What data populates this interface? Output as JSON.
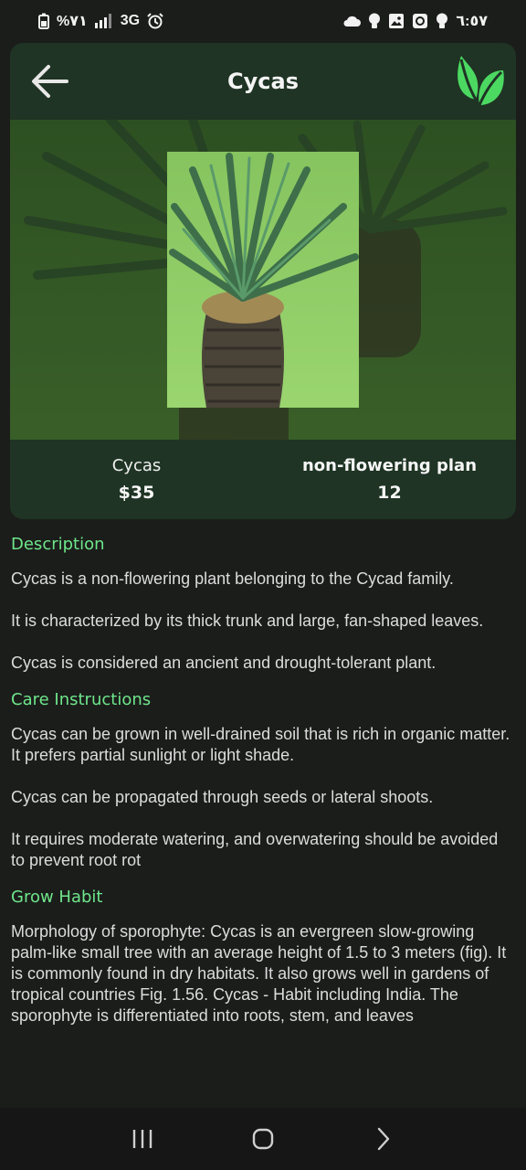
{
  "status_bar": {
    "battery": "%٧١",
    "network": "3G",
    "time": "٦:٥٧"
  },
  "header": {
    "title": "Cycas"
  },
  "plant": {
    "name": "Cycas",
    "price": "$35",
    "type": "non-flowering plan",
    "count": "12"
  },
  "sections": [
    {
      "heading": "Description",
      "paragraphs": [
        "Cycas is a non-flowering plant belonging to the Cycad family.",
        " It is characterized by its thick trunk and large, fan-shaped leaves.",
        "Cycas is considered an ancient and drought-tolerant plant."
      ]
    },
    {
      "heading": "Care Instructions",
      "paragraphs": [
        "Cycas can be grown in well-drained soil that is rich in organic matter. It prefers partial sunlight or light shade.",
        "Cycas can be propagated through seeds or lateral shoots.",
        "It requires moderate watering, and overwatering should be avoided to prevent root rot"
      ]
    },
    {
      "heading": "Grow Habit",
      "paragraphs": [
        "Morphology of sporophyte: Cycas is an evergreen slow-growing palm-like small tree with an average height of 1.5 to 3 meters (fig). It is commonly found in dry habitats. It also grows well in gardens of tropical countries Fig. 1.56. Cycas - Habit including India. The sporophyte is differentiated into roots, stem, and leaves"
      ]
    }
  ],
  "colors": {
    "accent_green": "#6ee68a",
    "card_bg": "#1f3424",
    "page_bg": "#1b1d1b"
  }
}
